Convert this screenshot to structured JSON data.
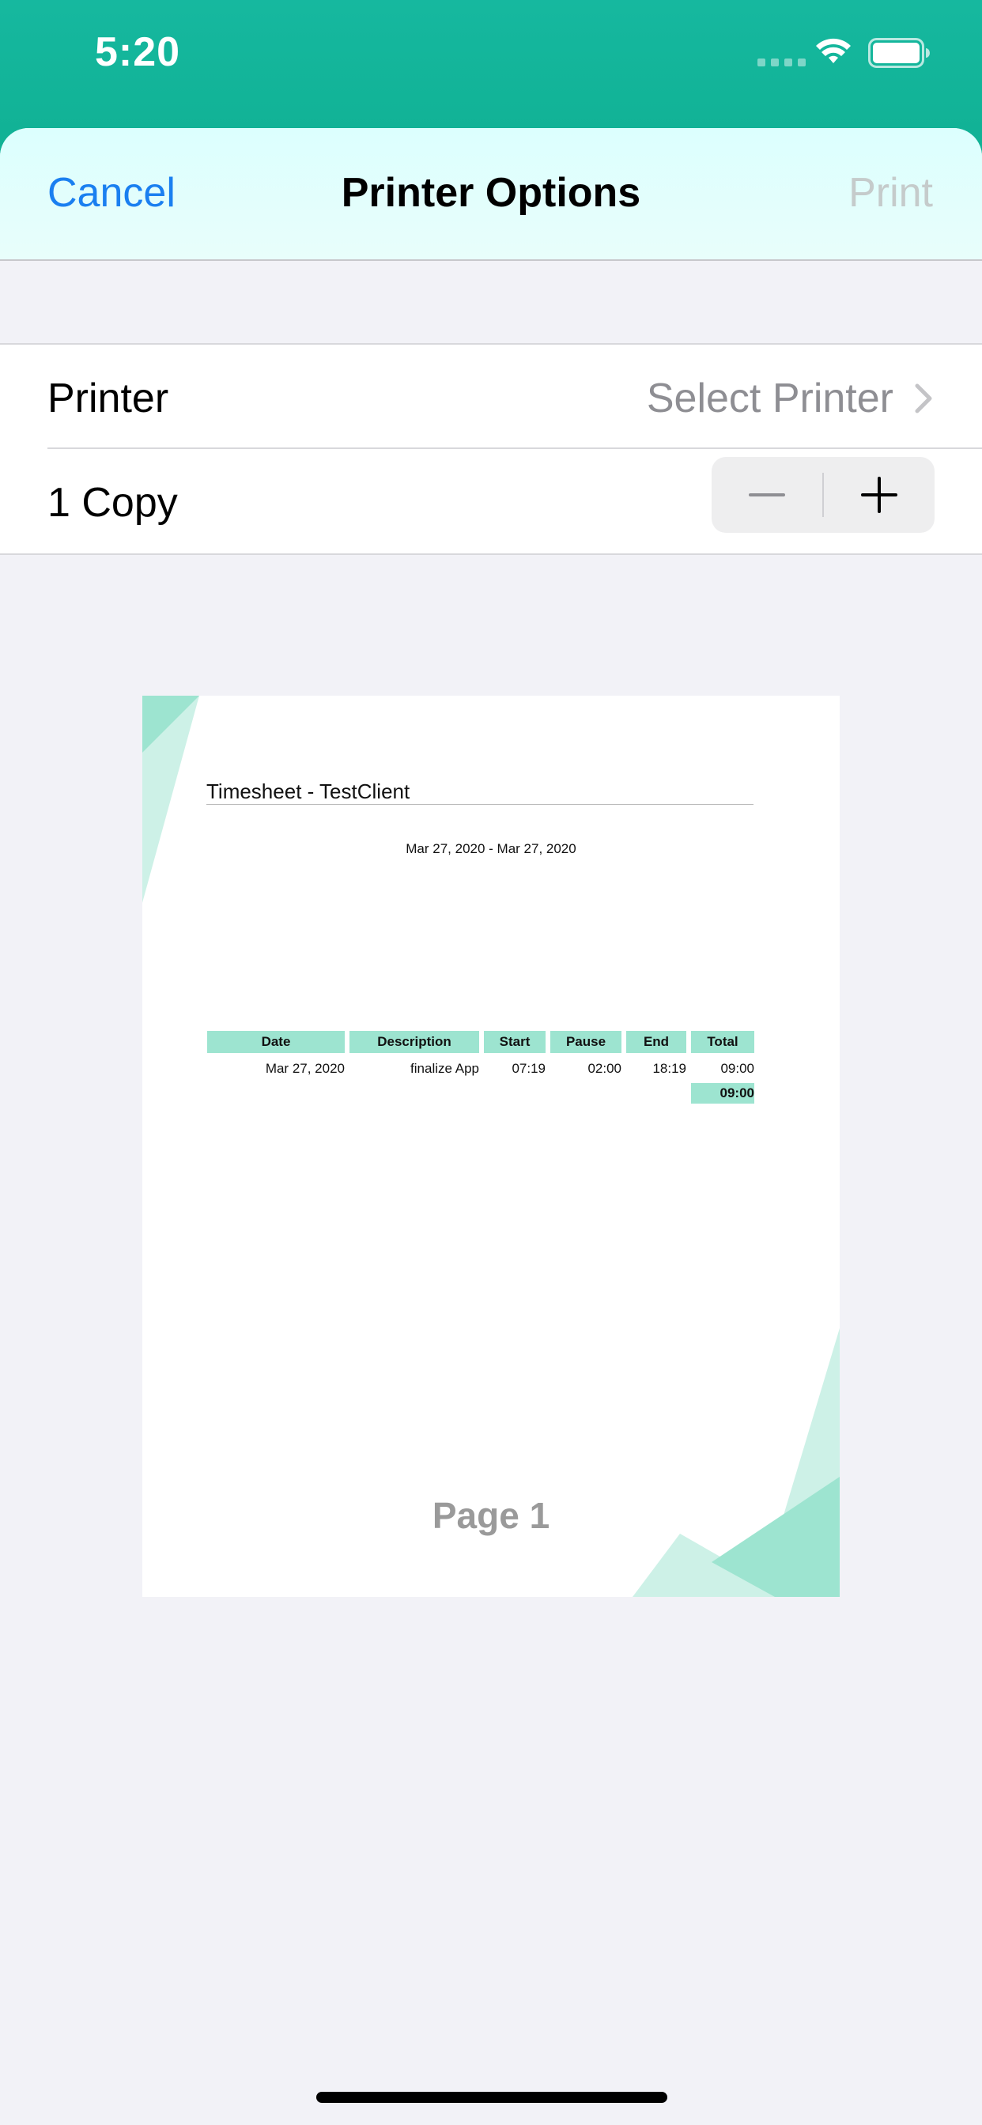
{
  "status_bar": {
    "time": "5:20"
  },
  "nav": {
    "cancel_label": "Cancel",
    "title": "Printer Options",
    "print_label": "Print"
  },
  "options": {
    "printer_label": "Printer",
    "printer_value": "Select Printer",
    "copies_label": "1 Copy"
  },
  "preview": {
    "title": "Timesheet - TestClient",
    "date_range": "Mar 27, 2020 - Mar 27, 2020",
    "columns": [
      "Date",
      "Description",
      "Start",
      "Pause",
      "End",
      "Total"
    ],
    "rows": [
      [
        "Mar 27, 2020",
        "finalize App",
        "07:19",
        "02:00",
        "18:19",
        "09:00"
      ]
    ],
    "total": "09:00",
    "page_label": "Page 1"
  },
  "colors": {
    "status_bar": "#16b89f",
    "nav_background": "#dcfffe",
    "accent_link": "#1a7ff0",
    "table_header": "#9de4d0",
    "page_background": "#f2f2f7"
  },
  "icons": {
    "status": [
      "signal-icon",
      "wifi-icon",
      "battery-icon"
    ],
    "printer_row": "chevron-right-icon",
    "stepper": [
      "minus-icon",
      "plus-icon"
    ]
  }
}
